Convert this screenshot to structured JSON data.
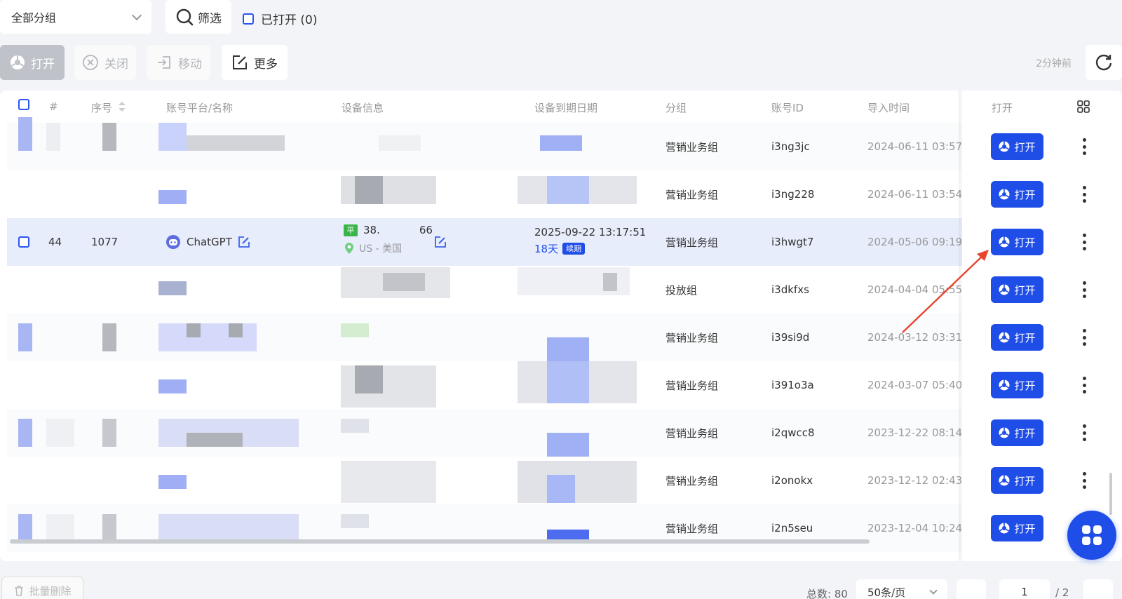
{
  "top": {
    "group_select": "全部分组",
    "filter_label": "筛选",
    "opened_label": "已打开 (0)"
  },
  "toolbar": {
    "open": "打开",
    "close": "关闭",
    "move": "移动",
    "more": "更多",
    "updated": "2分钟前"
  },
  "table": {
    "headers": {
      "hash": "#",
      "seq": "序号",
      "platform": "账号平台/名称",
      "device": "设备信息",
      "expire": "设备到期日期",
      "group": "分组",
      "account_id": "账号ID",
      "import_time": "导入时间",
      "open": "打开"
    },
    "open_btn": "打开",
    "rows": [
      {
        "group": "营销业务组",
        "account_id": "i3ng3jc",
        "import_time": "2024-06-11 03:57:"
      },
      {
        "group": "营销业务组",
        "account_id": "i3ng228",
        "import_time": "2024-06-11 03:54:"
      },
      {
        "index": "44",
        "seq": "1077",
        "platform": "ChatGPT",
        "device_ip": "38.",
        "device_ip_tail": "66",
        "device_badge": "平",
        "device_location": "US - 美国",
        "expire_date": "2025-09-22 13:17:51",
        "expire_days": "18天",
        "expire_badge": "续期",
        "group": "营销业务组",
        "account_id": "i3hwgt7",
        "import_time": "2024-05-06 09:19:"
      },
      {
        "group": "投放组",
        "account_id": "i3dkfxs",
        "import_time": "2024-04-04 05:55:"
      },
      {
        "group": "营销业务组",
        "account_id": "i39si9d",
        "import_time": "2024-03-12 03:31:"
      },
      {
        "group": "营销业务组",
        "account_id": "i391o3a",
        "import_time": "2024-03-07 05:40:"
      },
      {
        "group": "营销业务组",
        "account_id": "i2qwcc8",
        "import_time": "2023-12-22 08:14:"
      },
      {
        "group": "营销业务组",
        "account_id": "i2onokx",
        "import_time": "2023-12-12 02:43:"
      },
      {
        "group": "营销业务组",
        "account_id": "i2n5seu",
        "import_time": "2023-12-04 10:24:"
      }
    ]
  },
  "footer": {
    "bulk_delete": "批量删除",
    "total": "总数: 80",
    "page_size": "50条/页",
    "page": "1",
    "page_total": "/ 2"
  },
  "colors": {
    "primary": "#1f4de8",
    "highlight_row": "#e8edfc",
    "arrow": "#e8442e"
  }
}
